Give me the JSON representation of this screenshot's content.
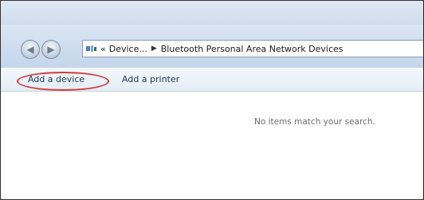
{
  "nav": {
    "back_glyph": "◀",
    "forward_glyph": "▶"
  },
  "address_bar": {
    "icon": "control-panel-icon",
    "overflow": "«",
    "crumb_1": "Device...",
    "separator": "▶",
    "crumb_2": "Bluetooth Personal Area Network Devices"
  },
  "toolbar": {
    "add_device_label": "Add a device",
    "add_printer_label": "Add a printer"
  },
  "content": {
    "empty_message": "No items match your search."
  },
  "colors": {
    "highlight": "#d23c3c",
    "toolbar_text": "#1e395b"
  }
}
